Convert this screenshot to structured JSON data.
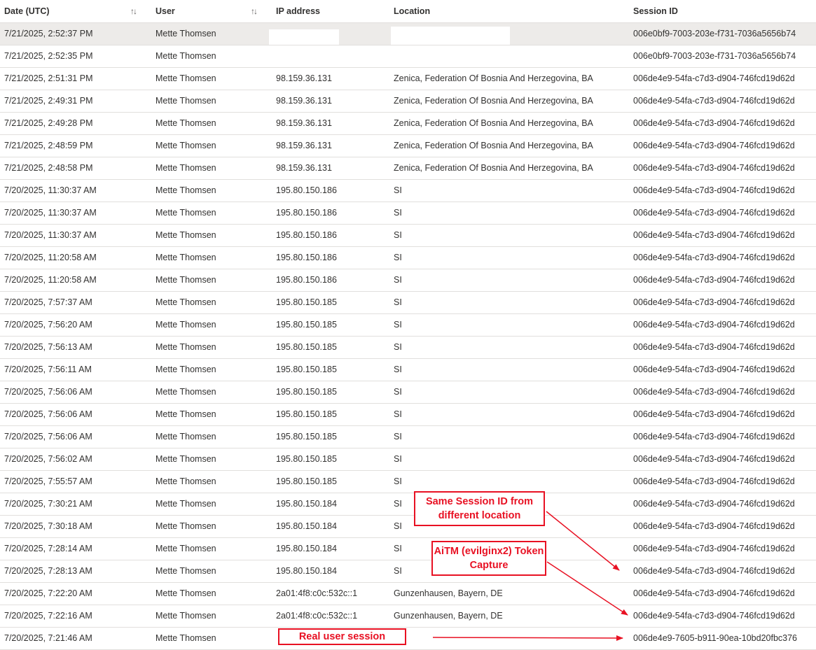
{
  "columns": {
    "date": "Date (UTC)",
    "user": "User",
    "ip": "IP address",
    "location": "Location",
    "session": "Session ID"
  },
  "sort_icon": "sort-arrows-icon",
  "rows": [
    {
      "date": "7/21/2025, 2:52:37 PM",
      "user": "Mette Thomsen",
      "ip": "",
      "location": "",
      "session": "006e0bf9-7003-203e-f731-7036a5656b74",
      "selected": true
    },
    {
      "date": "7/21/2025, 2:52:35 PM",
      "user": "Mette Thomsen",
      "ip": "",
      "location": "",
      "session": "006e0bf9-7003-203e-f731-7036a5656b74"
    },
    {
      "date": "7/21/2025, 2:51:31 PM",
      "user": "Mette Thomsen",
      "ip": "98.159.36.131",
      "location": "Zenica, Federation Of Bosnia And Herzegovina, BA",
      "session": "006de4e9-54fa-c7d3-d904-746fcd19d62d"
    },
    {
      "date": "7/21/2025, 2:49:31 PM",
      "user": "Mette Thomsen",
      "ip": "98.159.36.131",
      "location": "Zenica, Federation Of Bosnia And Herzegovina, BA",
      "session": "006de4e9-54fa-c7d3-d904-746fcd19d62d"
    },
    {
      "date": "7/21/2025, 2:49:28 PM",
      "user": "Mette Thomsen",
      "ip": "98.159.36.131",
      "location": "Zenica, Federation Of Bosnia And Herzegovina, BA",
      "session": "006de4e9-54fa-c7d3-d904-746fcd19d62d"
    },
    {
      "date": "7/21/2025, 2:48:59 PM",
      "user": "Mette Thomsen",
      "ip": "98.159.36.131",
      "location": "Zenica, Federation Of Bosnia And Herzegovina, BA",
      "session": "006de4e9-54fa-c7d3-d904-746fcd19d62d"
    },
    {
      "date": "7/21/2025, 2:48:58 PM",
      "user": "Mette Thomsen",
      "ip": "98.159.36.131",
      "location": "Zenica, Federation Of Bosnia And Herzegovina, BA",
      "session": "006de4e9-54fa-c7d3-d904-746fcd19d62d"
    },
    {
      "date": "7/20/2025, 11:30:37 AM",
      "user": "Mette Thomsen",
      "ip": "195.80.150.186",
      "location": "SI",
      "session": "006de4e9-54fa-c7d3-d904-746fcd19d62d"
    },
    {
      "date": "7/20/2025, 11:30:37 AM",
      "user": "Mette Thomsen",
      "ip": "195.80.150.186",
      "location": "SI",
      "session": "006de4e9-54fa-c7d3-d904-746fcd19d62d"
    },
    {
      "date": "7/20/2025, 11:30:37 AM",
      "user": "Mette Thomsen",
      "ip": "195.80.150.186",
      "location": "SI",
      "session": "006de4e9-54fa-c7d3-d904-746fcd19d62d"
    },
    {
      "date": "7/20/2025, 11:20:58 AM",
      "user": "Mette Thomsen",
      "ip": "195.80.150.186",
      "location": "SI",
      "session": "006de4e9-54fa-c7d3-d904-746fcd19d62d"
    },
    {
      "date": "7/20/2025, 11:20:58 AM",
      "user": "Mette Thomsen",
      "ip": "195.80.150.186",
      "location": "SI",
      "session": "006de4e9-54fa-c7d3-d904-746fcd19d62d"
    },
    {
      "date": "7/20/2025, 7:57:37 AM",
      "user": "Mette Thomsen",
      "ip": "195.80.150.185",
      "location": "SI",
      "session": "006de4e9-54fa-c7d3-d904-746fcd19d62d"
    },
    {
      "date": "7/20/2025, 7:56:20 AM",
      "user": "Mette Thomsen",
      "ip": "195.80.150.185",
      "location": "SI",
      "session": "006de4e9-54fa-c7d3-d904-746fcd19d62d"
    },
    {
      "date": "7/20/2025, 7:56:13 AM",
      "user": "Mette Thomsen",
      "ip": "195.80.150.185",
      "location": "SI",
      "session": "006de4e9-54fa-c7d3-d904-746fcd19d62d"
    },
    {
      "date": "7/20/2025, 7:56:11 AM",
      "user": "Mette Thomsen",
      "ip": "195.80.150.185",
      "location": "SI",
      "session": "006de4e9-54fa-c7d3-d904-746fcd19d62d"
    },
    {
      "date": "7/20/2025, 7:56:06 AM",
      "user": "Mette Thomsen",
      "ip": "195.80.150.185",
      "location": "SI",
      "session": "006de4e9-54fa-c7d3-d904-746fcd19d62d"
    },
    {
      "date": "7/20/2025, 7:56:06 AM",
      "user": "Mette Thomsen",
      "ip": "195.80.150.185",
      "location": "SI",
      "session": "006de4e9-54fa-c7d3-d904-746fcd19d62d"
    },
    {
      "date": "7/20/2025, 7:56:06 AM",
      "user": "Mette Thomsen",
      "ip": "195.80.150.185",
      "location": "SI",
      "session": "006de4e9-54fa-c7d3-d904-746fcd19d62d"
    },
    {
      "date": "7/20/2025, 7:56:02 AM",
      "user": "Mette Thomsen",
      "ip": "195.80.150.185",
      "location": "SI",
      "session": "006de4e9-54fa-c7d3-d904-746fcd19d62d"
    },
    {
      "date": "7/20/2025, 7:55:57 AM",
      "user": "Mette Thomsen",
      "ip": "195.80.150.185",
      "location": "SI",
      "session": "006de4e9-54fa-c7d3-d904-746fcd19d62d"
    },
    {
      "date": "7/20/2025, 7:30:21 AM",
      "user": "Mette Thomsen",
      "ip": "195.80.150.184",
      "location": "SI",
      "session": "006de4e9-54fa-c7d3-d904-746fcd19d62d"
    },
    {
      "date": "7/20/2025, 7:30:18 AM",
      "user": "Mette Thomsen",
      "ip": "195.80.150.184",
      "location": "SI",
      "session": "006de4e9-54fa-c7d3-d904-746fcd19d62d"
    },
    {
      "date": "7/20/2025, 7:28:14 AM",
      "user": "Mette Thomsen",
      "ip": "195.80.150.184",
      "location": "SI",
      "session": "006de4e9-54fa-c7d3-d904-746fcd19d62d"
    },
    {
      "date": "7/20/2025, 7:28:13 AM",
      "user": "Mette Thomsen",
      "ip": "195.80.150.184",
      "location": "SI",
      "session": "006de4e9-54fa-c7d3-d904-746fcd19d62d"
    },
    {
      "date": "7/20/2025, 7:22:20 AM",
      "user": "Mette Thomsen",
      "ip": "2a01:4f8:c0c:532c::1",
      "location": "Gunzenhausen, Bayern, DE",
      "session": "006de4e9-54fa-c7d3-d904-746fcd19d62d"
    },
    {
      "date": "7/20/2025, 7:22:16 AM",
      "user": "Mette Thomsen",
      "ip": "2a01:4f8:c0c:532c::1",
      "location": "Gunzenhausen, Bayern, DE",
      "session": "006de4e9-54fa-c7d3-d904-746fcd19d62d"
    },
    {
      "date": "7/20/2025, 7:21:46 AM",
      "user": "Mette Thomsen",
      "ip": "",
      "location": "",
      "session": "006de4e9-7605-b911-90ea-10bd20fbc376"
    }
  ],
  "annotations": {
    "same_session": "Same Session ID from different location",
    "aitm": "AiTM (evilginx2) Token Capture",
    "real_user": "Real user session",
    "color": "#e81123"
  }
}
